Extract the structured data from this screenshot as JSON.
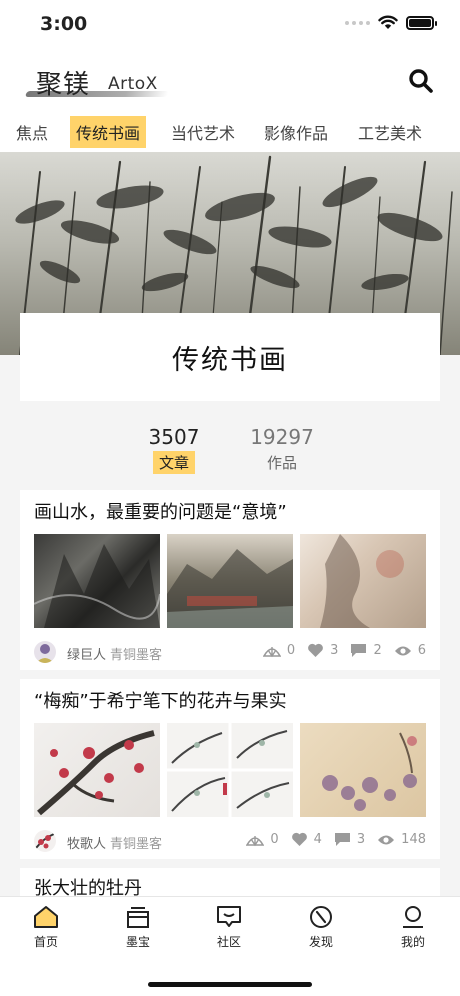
{
  "status": {
    "time": "3:00"
  },
  "header": {
    "logo_cn": "聚镁",
    "logo_en": "ArtoX"
  },
  "tabs": [
    {
      "label": "焦点"
    },
    {
      "label": "传统书画",
      "active": true
    },
    {
      "label": "当代艺术"
    },
    {
      "label": "影像作品"
    },
    {
      "label": "工艺美术"
    }
  ],
  "hero": {
    "title": "传统书画"
  },
  "stats": [
    {
      "value": "3507",
      "label": "文章",
      "active": true
    },
    {
      "value": "19297",
      "label": "作品",
      "active": false
    }
  ],
  "articles": [
    {
      "title": "画山水，最重要的问题是“意境”",
      "author": "绿巨人",
      "category": "青铜墨客",
      "counts": {
        "shares": "0",
        "likes": "3",
        "comments": "2",
        "views": "6"
      }
    },
    {
      "title": "“梅痴”于希宁笔下的花卉与果实",
      "author": "牧歌人",
      "category": "青铜墨客",
      "counts": {
        "shares": "0",
        "likes": "4",
        "comments": "3",
        "views": "148"
      }
    },
    {
      "title": "张大壮的牡丹"
    }
  ],
  "nav": [
    {
      "label": "首页",
      "icon": "home-icon"
    },
    {
      "label": "墨宝",
      "icon": "wallet-icon"
    },
    {
      "label": "社区",
      "icon": "chat-icon"
    },
    {
      "label": "发现",
      "icon": "compass-icon"
    },
    {
      "label": "我的",
      "icon": "profile-icon"
    }
  ],
  "colors": {
    "accent": "#ffd36a",
    "text": "#222222",
    "muted": "#999999"
  }
}
